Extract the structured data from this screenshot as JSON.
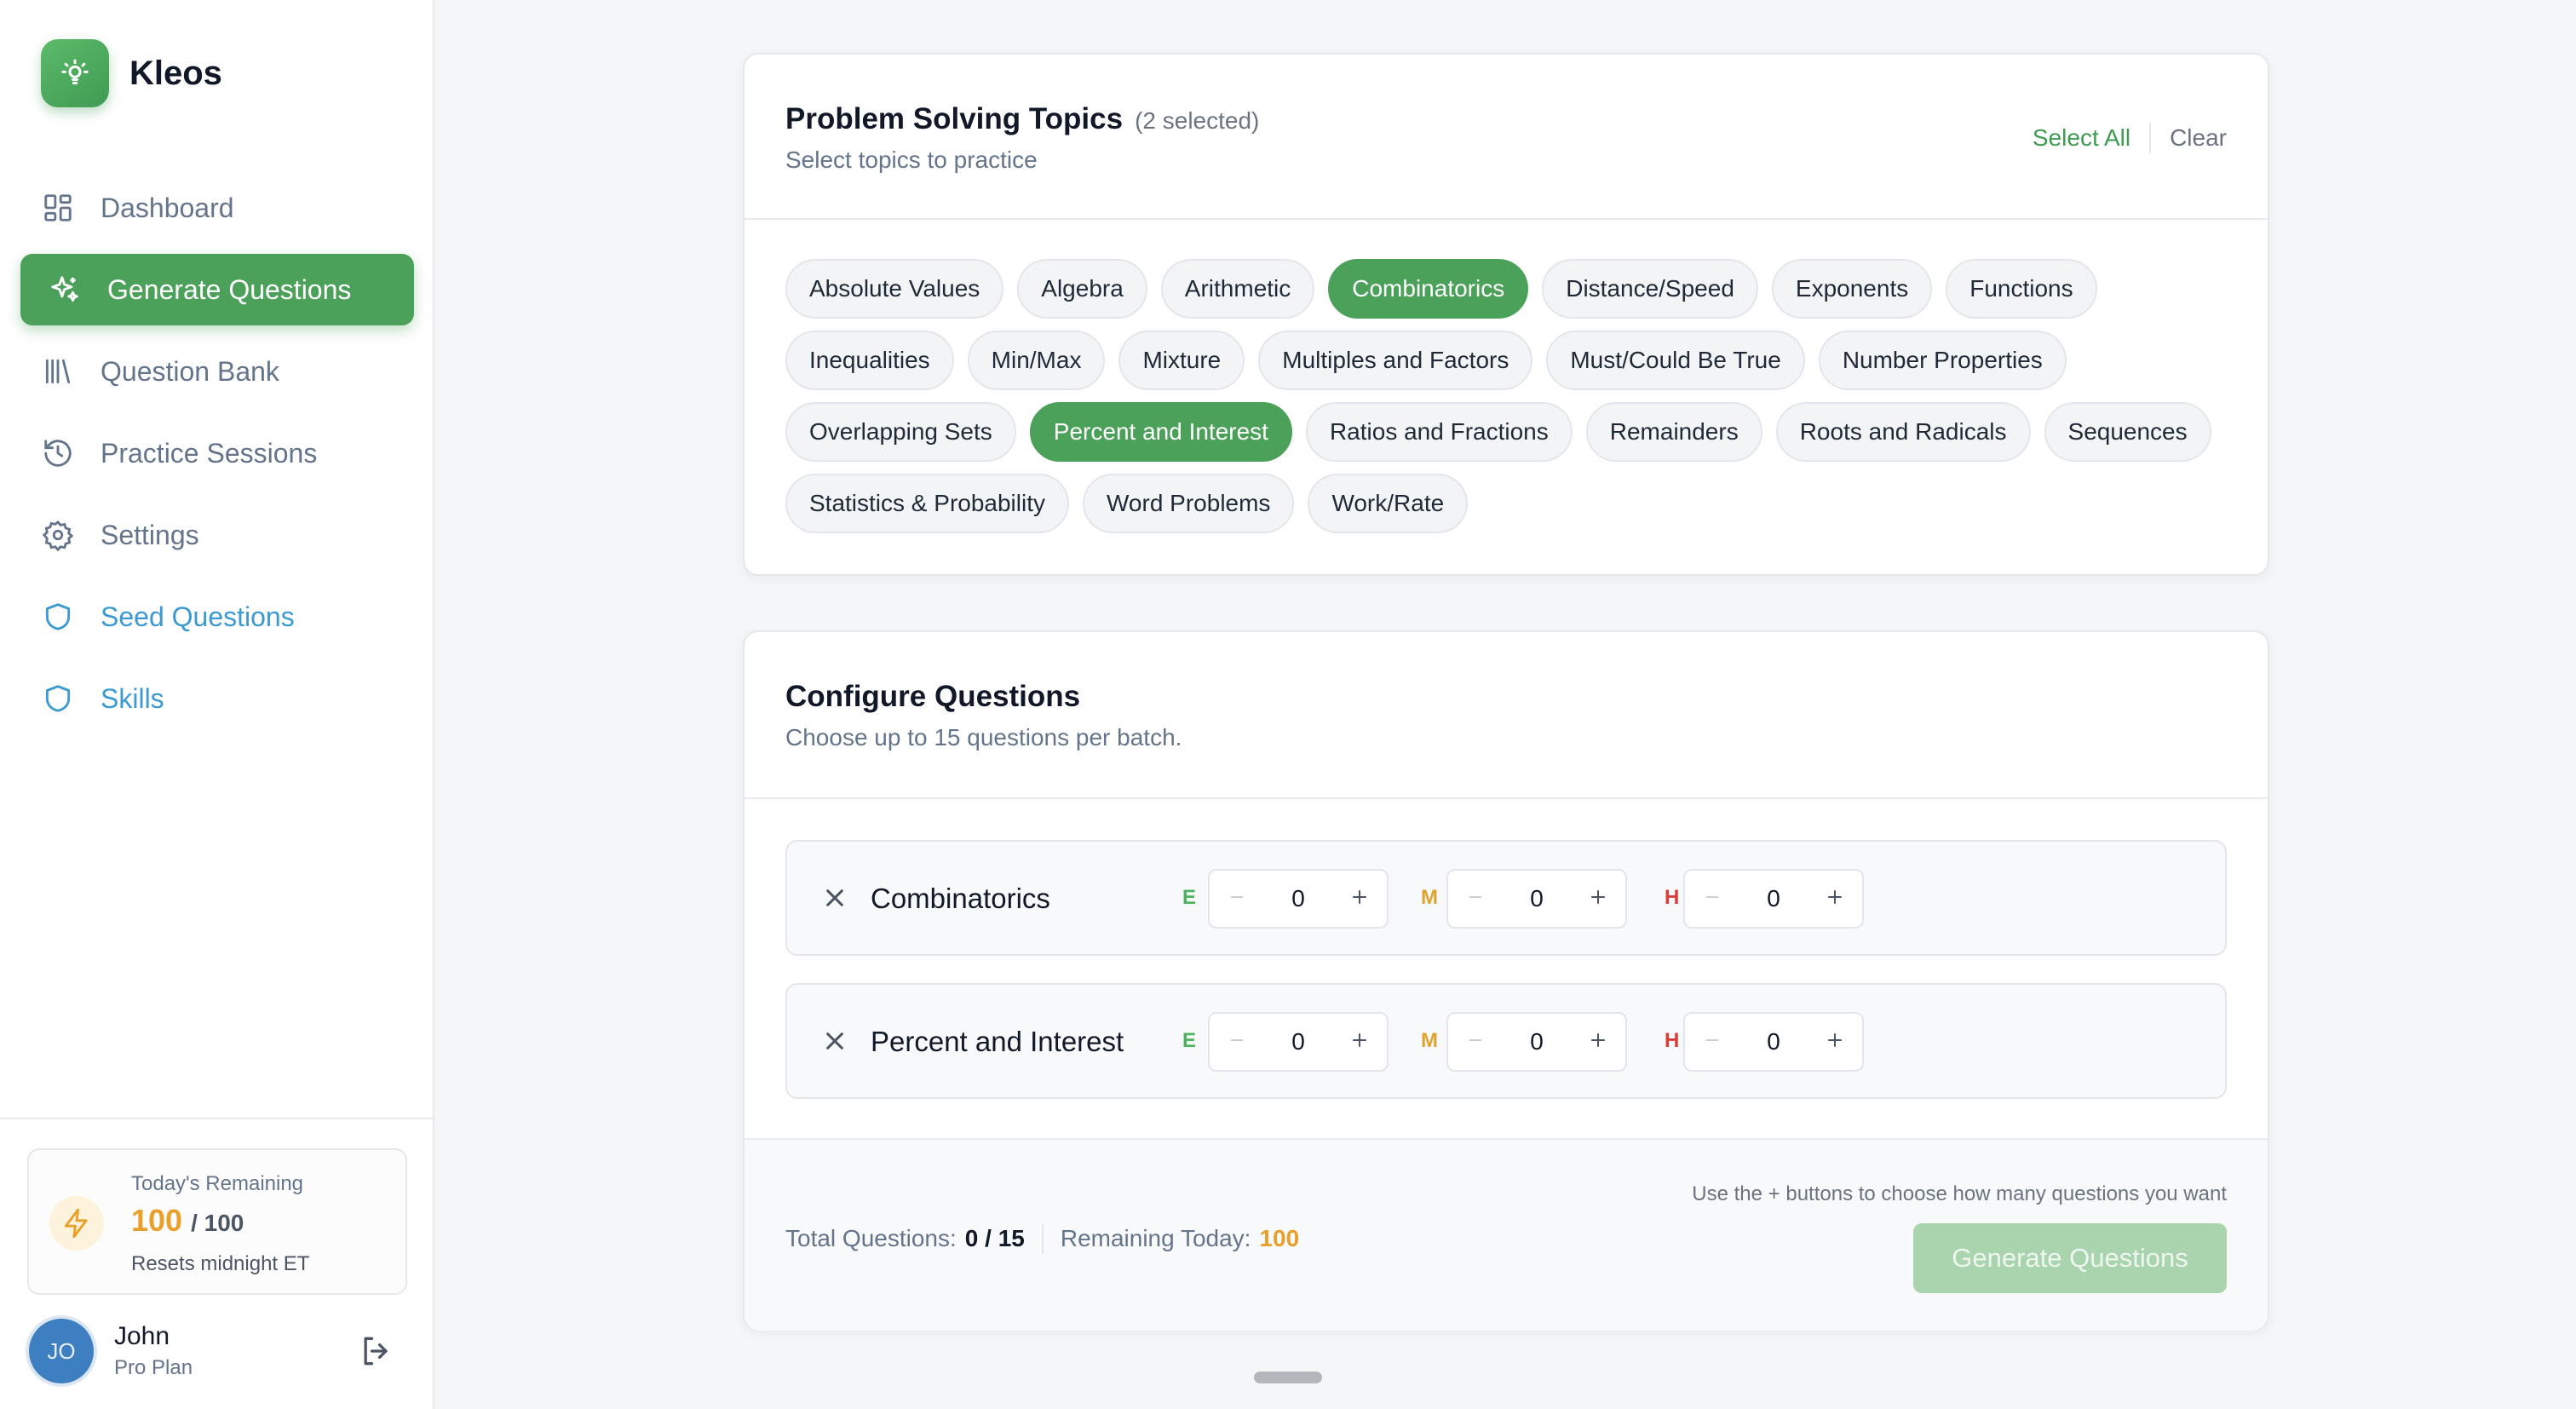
{
  "app": {
    "name": "Kleos"
  },
  "colors": {
    "accent": "#4ba159",
    "link_blue": "#3b9ad2",
    "amber": "#e9a02a",
    "easy": "#4fb35e",
    "medium": "#e0a32f",
    "hard": "#dc3b3b"
  },
  "sidebar": {
    "items": [
      {
        "label": "Dashboard",
        "icon": "dashboard-icon"
      },
      {
        "label": "Generate Questions",
        "icon": "sparkles-icon",
        "active": true
      },
      {
        "label": "Question Bank",
        "icon": "library-icon"
      },
      {
        "label": "Practice Sessions",
        "icon": "history-icon"
      },
      {
        "label": "Settings",
        "icon": "gear-icon"
      },
      {
        "label": "Seed Questions",
        "icon": "shield-icon"
      },
      {
        "label": "Skills",
        "icon": "shield-icon"
      }
    ],
    "quota": {
      "label": "Today's Remaining",
      "remaining": "100",
      "total": "/ 100",
      "reset": "Resets midnight ET"
    },
    "user": {
      "initials": "JO",
      "name": "John",
      "plan": "Pro Plan"
    }
  },
  "topics": {
    "title": "Problem Solving Topics",
    "selected_count": "(2 selected)",
    "subtitle": "Select topics to practice",
    "select_all": "Select All",
    "clear": "Clear",
    "chips": [
      "Absolute Values",
      "Algebra",
      "Arithmetic",
      "Combinatorics",
      "Distance/Speed",
      "Exponents",
      "Functions",
      "Inequalities",
      "Min/Max",
      "Mixture",
      "Multiples and Factors",
      "Must/Could Be True",
      "Number Properties",
      "Overlapping Sets",
      "Percent and Interest",
      "Ratios and Fractions",
      "Remainders",
      "Roots and Radicals",
      "Sequences",
      "Statistics & Probability",
      "Word Problems",
      "Work/Rate"
    ],
    "selected": [
      "Combinatorics",
      "Percent and Interest"
    ]
  },
  "config": {
    "title": "Configure Questions",
    "subtitle": "Choose up to 15 questions per batch.",
    "level_labels": {
      "easy": "E",
      "medium": "M",
      "hard": "H"
    },
    "rows": [
      {
        "topic": "Combinatorics",
        "easy": "0",
        "medium": "0",
        "hard": "0"
      },
      {
        "topic": "Percent and Interest",
        "easy": "0",
        "medium": "0",
        "hard": "0"
      }
    ],
    "footer": {
      "hint": "Use the + buttons to choose how many questions you want",
      "total_label": "Total Questions:",
      "total_value": "0 / 15",
      "remaining_label": "Remaining Today:",
      "remaining_value": "100",
      "generate_label": "Generate Questions"
    }
  }
}
